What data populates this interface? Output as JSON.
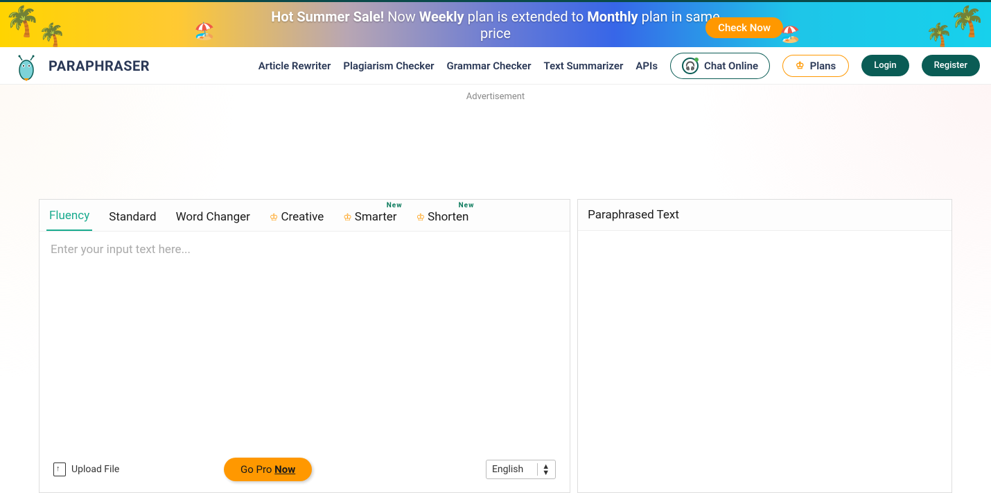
{
  "banner": {
    "text_prefix": "Hot Summer Sale!",
    "text_mid1": " Now ",
    "text_bold1": "Weekly",
    "text_mid2": " plan is extended to ",
    "text_bold2": "Monthly",
    "text_suffix": " plan in same price",
    "check_now": "Check Now"
  },
  "header": {
    "brand": "PARAPHRASER",
    "nav": {
      "article_rewriter": "Article Rewriter",
      "plagiarism_checker": "Plagiarism Checker",
      "grammar_checker": "Grammar Checker",
      "text_summarizer": "Text Summarizer",
      "apis": "APIs"
    },
    "chat_online": "Chat Online",
    "plans": "Plans",
    "login": "Login",
    "register": "Register"
  },
  "ad_label": "Advertisement",
  "tabs": {
    "fluency": "Fluency",
    "standard": "Standard",
    "word_changer": "Word Changer",
    "creative": "Creative",
    "smarter": "Smarter",
    "shorten": "Shorten",
    "new_badge": "New"
  },
  "input": {
    "placeholder": "Enter your input text here..."
  },
  "bottom": {
    "upload_file": "Upload File",
    "go_pro_prefix": "Go Pro ",
    "go_pro_now": "Now",
    "language": "English"
  },
  "output": {
    "title": "Paraphrased Text"
  }
}
